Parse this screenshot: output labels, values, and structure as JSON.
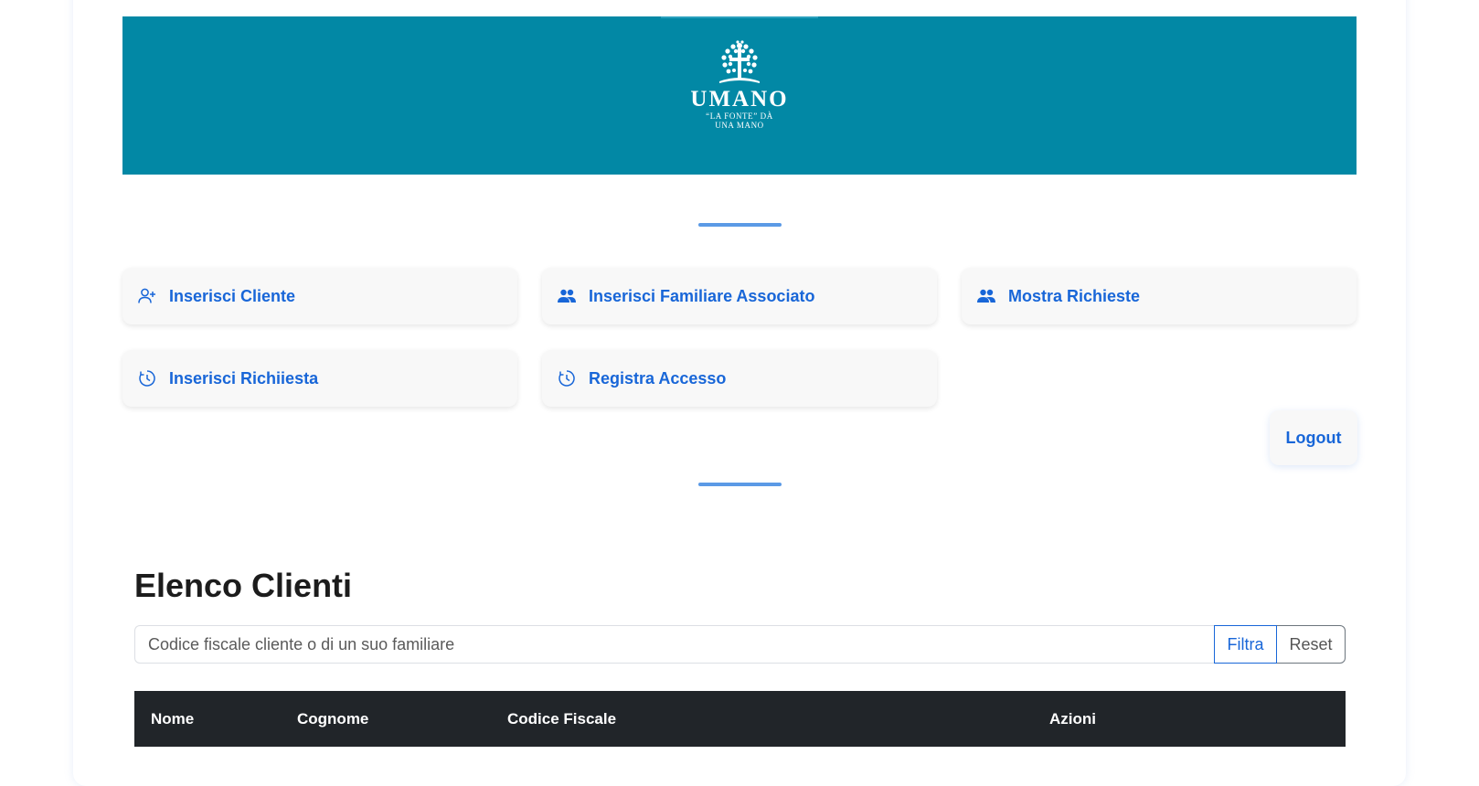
{
  "banner": {
    "logo_title": "UMANO",
    "logo_motto_line1": "“LA FONTE” DÀ",
    "logo_motto_line2": "UNA MANO",
    "background_color": "#0288a5"
  },
  "nav": {
    "items": [
      {
        "label": "Inserisci Cliente",
        "icon": "add-user-icon"
      },
      {
        "label": "Inserisci Familiare Associato",
        "icon": "users-icon"
      },
      {
        "label": "Mostra Richieste",
        "icon": "users-icon"
      },
      {
        "label": "Inserisci Richiiesta",
        "icon": "clock-icon"
      },
      {
        "label": "Registra Accesso",
        "icon": "clock-icon"
      }
    ],
    "logout_label": "Logout",
    "link_color": "#1866d8"
  },
  "clients": {
    "title": "Elenco Clienti",
    "search_placeholder": "Codice fiscale cliente o di un suo familiare",
    "filter_label": "Filtra",
    "reset_label": "Reset",
    "columns": [
      "Nome",
      "Cognome",
      "Codice Fiscale",
      "Azioni"
    ]
  }
}
